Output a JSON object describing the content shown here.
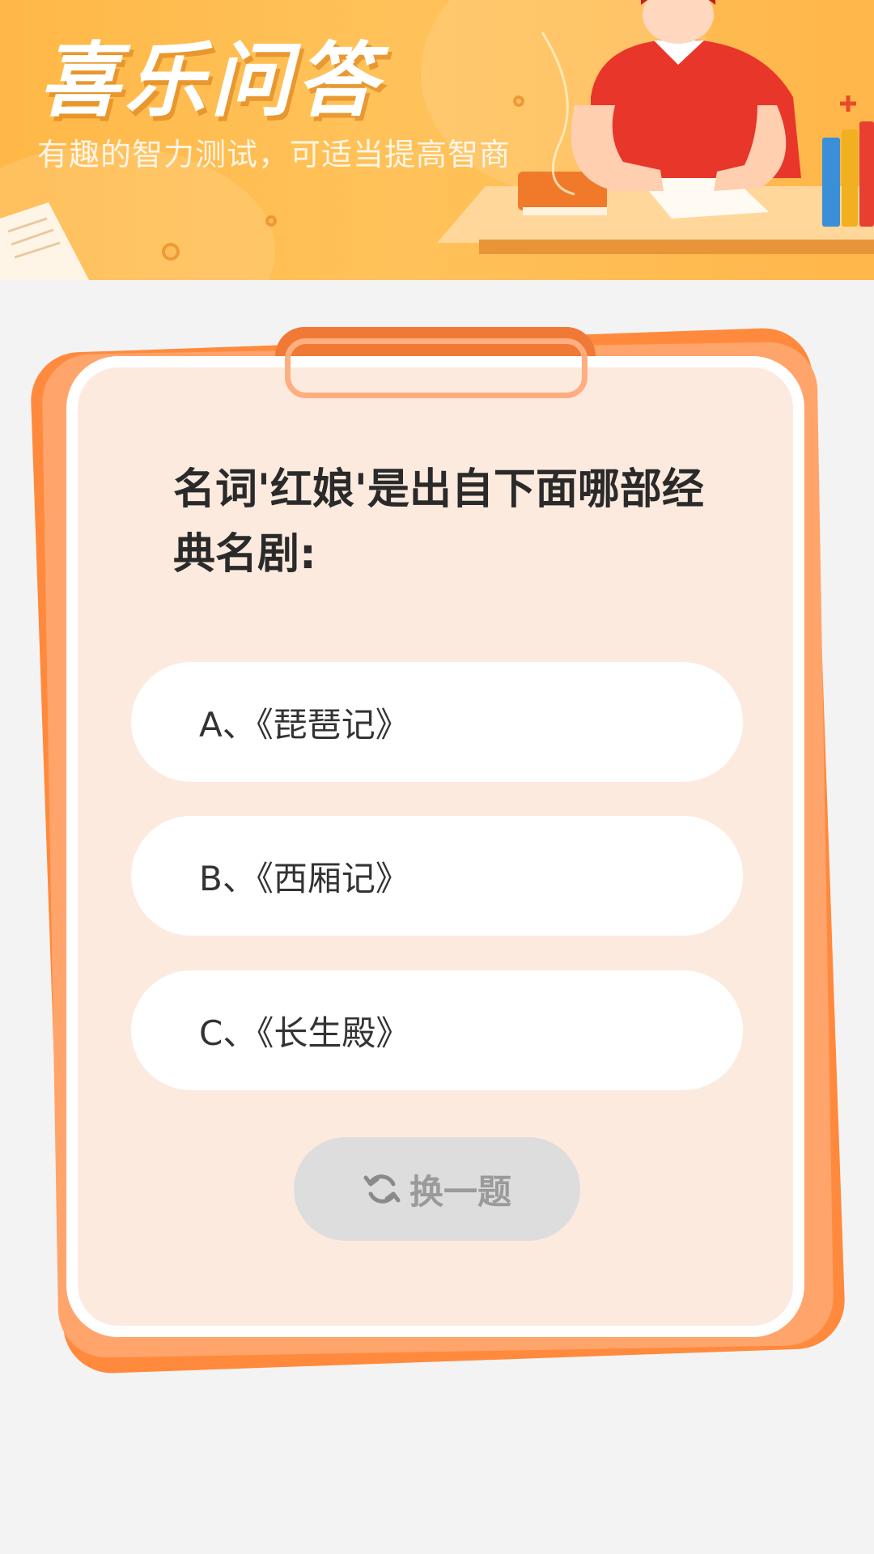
{
  "banner": {
    "title": "喜乐问答",
    "subtitle": "有趣的智力测试，可适当提高智商"
  },
  "quiz": {
    "question": "名词'红娘'是出自下面哪部经典名剧:",
    "options": [
      {
        "label": "A、《琵琶记》"
      },
      {
        "label": "B、《西厢记》"
      },
      {
        "label": "C、《长生殿》"
      }
    ],
    "swap_label": "换一题"
  },
  "icons": {
    "swap": "refresh-icon"
  },
  "colors": {
    "banner": "#ffb847",
    "card_bg": "#fdeadf",
    "card_frame": "#ff8a3d",
    "button_disabled": "#dddddd"
  }
}
